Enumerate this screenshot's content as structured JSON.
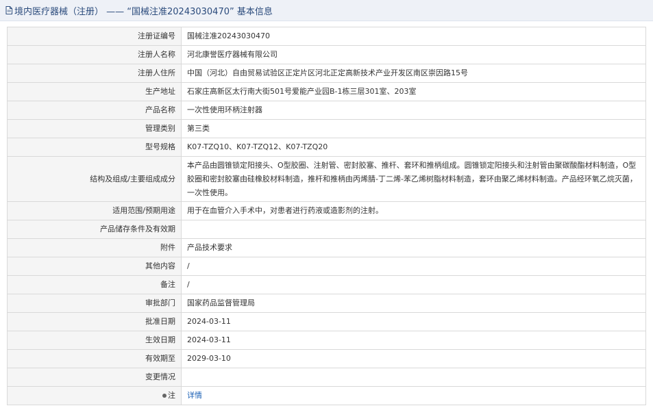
{
  "header": {
    "title": "境内医疗器械（注册） —— “国械注准20243030470” 基本信息"
  },
  "rows": [
    {
      "label": "注册证编号",
      "value": "国械注准20243030470"
    },
    {
      "label": "注册人名称",
      "value": "河北康誉医疗器械有限公司"
    },
    {
      "label": "注册人住所",
      "value": "中国（河北）自由贸易试验区正定片区河北正定高新技术产业开发区南区崇因路15号"
    },
    {
      "label": "生产地址",
      "value": "石家庄高新区太行南大街501号爱能产业园B-1栋三层301室、203室"
    },
    {
      "label": "产品名称",
      "value": "一次性使用环柄注射器"
    },
    {
      "label": "管理类别",
      "value": "第三类"
    },
    {
      "label": "型号规格",
      "value": "K07-TZQ10、K07-TZQ12、K07-TZQ20"
    },
    {
      "label": "结构及组成/主要组成成分",
      "value": "本产品由圆锥锁定阳接头、O型胶圈、注射管、密封胶塞、推杆、套环和推柄组成。圆锥锁定阳接头和注射管由聚碳酸酯材料制造，O型胶圈和密封胶塞由硅橡胶材料制造，推杆和推柄由丙烯腈-丁二烯-苯乙烯树脂材料制造，套环由聚乙烯材料制造。产品经环氧乙烷灭菌，一次性使用。"
    },
    {
      "label": "适用范围/预期用途",
      "value": "用于在血管介入手术中，对患者进行药液或造影剂的注射。"
    },
    {
      "label": "产品储存条件及有效期",
      "value": ""
    },
    {
      "label": "附件",
      "value": "产品技术要求"
    },
    {
      "label": "其他内容",
      "value": "/"
    },
    {
      "label": "备注",
      "value": "/"
    },
    {
      "label": "审批部门",
      "value": "国家药品监督管理局"
    },
    {
      "label": "批准日期",
      "value": "2024-03-11"
    },
    {
      "label": "生效日期",
      "value": "2024-03-11"
    },
    {
      "label": "有效期至",
      "value": "2029-03-10"
    },
    {
      "label": "变更情况",
      "value": ""
    },
    {
      "label": "注",
      "value": "详情"
    }
  ]
}
